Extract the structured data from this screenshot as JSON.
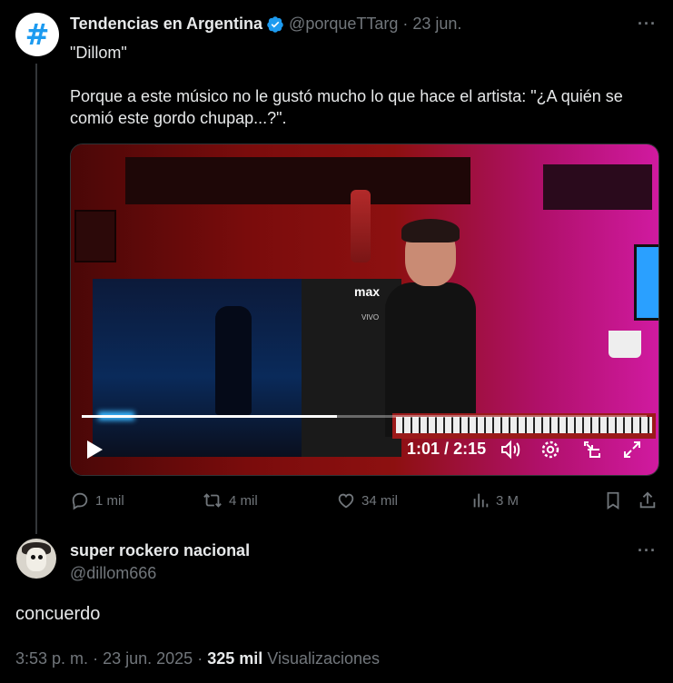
{
  "quoted_tweet": {
    "account_name": "Tendencias en Argentina",
    "avatar_glyph": "#",
    "handle": "@porqueTTarg",
    "separator": "·",
    "date": "23 jun.",
    "more_label": "···",
    "line1": "\"Dillom\"",
    "line2": "Porque a este músico no le gustó mucho lo que hace el artista: \"¿A quién se comió este gordo chupap...?\".",
    "video": {
      "overlay_logo": "max",
      "overlay_sub": "VIVO",
      "current_time": "1:01",
      "time_separator": "/",
      "duration": "2:15",
      "progress": 0.452
    },
    "actions": {
      "replies": "1 mil",
      "reposts": "4 mil",
      "likes": "34 mil",
      "views": "3 M"
    }
  },
  "reply": {
    "name": "super rockero nacional",
    "handle": "@dillom666",
    "more_label": "···",
    "text": "concuerdo",
    "time": "3:53 p. m.",
    "dot1": "·",
    "date": "23 jun. 2025",
    "dot2": "·",
    "views_count": "325 mil",
    "views_label": "Visualizaciones"
  },
  "colors": {
    "background": "#000000",
    "text_primary": "#e7e9ea",
    "text_secondary": "#71767b",
    "verified_badge": "#1d9bf0",
    "divider": "#2f3336"
  },
  "icons": [
    "verified-badge-icon",
    "more-icon",
    "play-icon",
    "volume-icon",
    "settings-icon",
    "pip-icon",
    "fullscreen-icon",
    "reply-icon",
    "repost-icon",
    "like-icon",
    "views-icon",
    "bookmark-icon",
    "share-icon"
  ]
}
